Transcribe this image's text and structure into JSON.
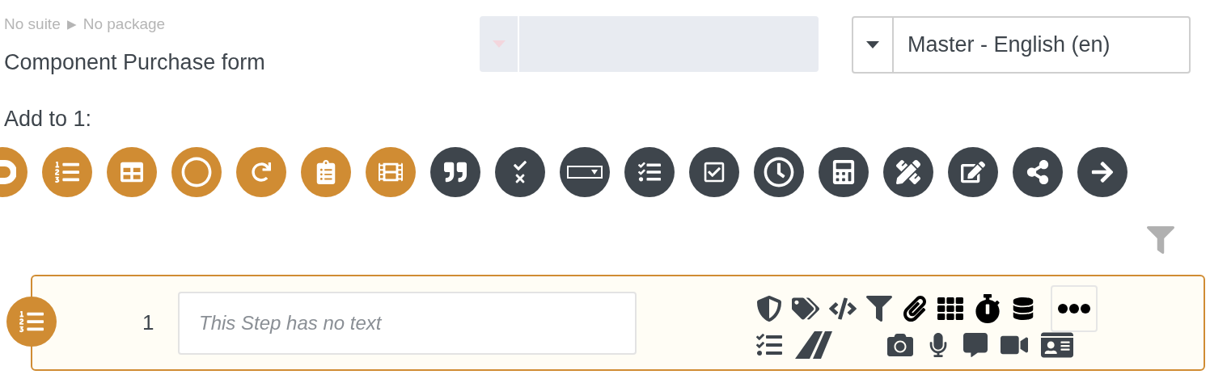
{
  "breadcrumb": {
    "suite": "No suite",
    "separator": "▶",
    "package": "No package"
  },
  "title": "Component Purchase form",
  "language_select": {
    "value": "Master - English (en)"
  },
  "add_label": "Add to 1:",
  "palette": [
    {
      "kind": "loop",
      "color": "#d08c33"
    },
    {
      "kind": "numbered-list",
      "color": "#d08c33"
    },
    {
      "kind": "table",
      "color": "#d08c33"
    },
    {
      "kind": "circle",
      "color": "#d08c33"
    },
    {
      "kind": "link",
      "color": "#d08c33"
    },
    {
      "kind": "clipboard",
      "color": "#d08c33"
    },
    {
      "kind": "film",
      "color": "#d08c33"
    },
    {
      "kind": "quote",
      "color": "#3e454c"
    },
    {
      "kind": "check-cross",
      "color": "#3e454c"
    },
    {
      "kind": "dropdown",
      "color": "#3e454c"
    },
    {
      "kind": "checklist",
      "color": "#3e454c"
    },
    {
      "kind": "checkbox",
      "color": "#3e454c"
    },
    {
      "kind": "clock",
      "color": "#3e454c"
    },
    {
      "kind": "calculator",
      "color": "#3e454c"
    },
    {
      "kind": "pencil-ruler",
      "color": "#3e454c"
    },
    {
      "kind": "sign",
      "color": "#3e454c"
    },
    {
      "kind": "share",
      "color": "#3e454c"
    },
    {
      "kind": "arrow",
      "color": "#3e454c"
    }
  ],
  "step": {
    "number": "1",
    "placeholder": "This Step has no text"
  }
}
